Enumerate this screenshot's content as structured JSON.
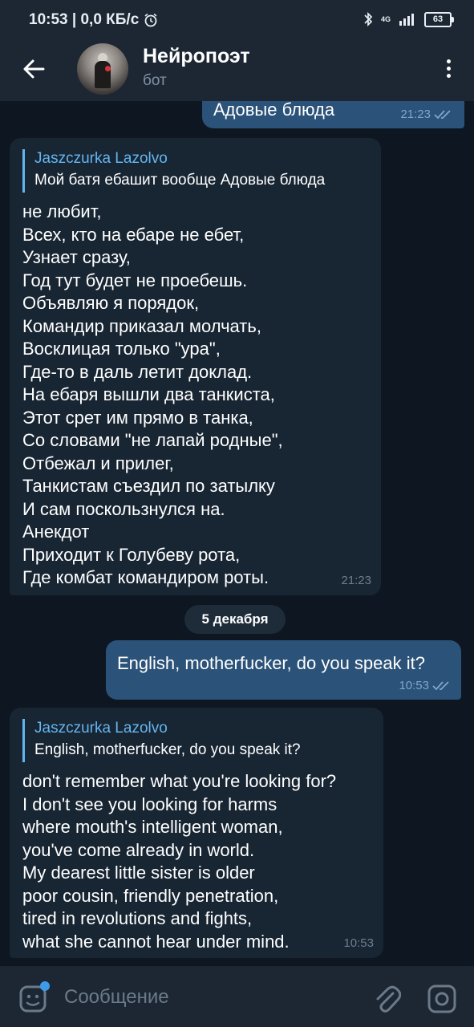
{
  "status_bar": {
    "time_speed": "10:53 | 0,0 КБ/с",
    "network": "4G",
    "battery": "63"
  },
  "header": {
    "title": "Нейропоэт",
    "subtitle": "бот"
  },
  "messages": [
    {
      "type": "outgoing",
      "text": "Адовые блюда",
      "time": "21:23"
    },
    {
      "type": "incoming",
      "reply_name": "Jaszczurka Lazolvo",
      "reply_text": "Мой батя ебашит вообще Адовые блюда",
      "lines": [
        "не любит,",
        "Всех, кто на ебаре не ебет,",
        "Узнает сразу,",
        "Год тут будет не проебешь.",
        "Объявляю я порядок,",
        "Командир приказал молчать,",
        "Восклицая только \"ура\",",
        "Где-то в даль летит доклад.",
        "На ебаря вышли два танкиста,",
        "Этот срет им прямо в танка,",
        "Со словами \"не лапай родные\",",
        "Отбежал и прилег,",
        "Танкистам съездил по затылку",
        "И сам поскользнулся на.",
        "Анекдот",
        "Приходит к Голубеву рота,",
        "Где комбат командиром роты."
      ],
      "time": "21:23"
    },
    {
      "type": "date",
      "text": "5 декабря"
    },
    {
      "type": "outgoing",
      "text": "English, motherfucker, do you speak it?",
      "time": "10:53"
    },
    {
      "type": "incoming",
      "reply_name": "Jaszczurka Lazolvo",
      "reply_text": "English, motherfucker, do you speak it?",
      "lines": [
        "don't remember what you're looking for?",
        "I don't see you looking for harms",
        "where mouth's intelligent woman,",
        "you've come already in world.",
        "My dearest little sister is older",
        "poor cousin, friendly penetration,",
        "tired in revolutions and fights,",
        "what she cannot hear under mind."
      ],
      "time": "10:53"
    }
  ],
  "composer": {
    "placeholder": "Сообщение"
  },
  "colors": {
    "background": "#0e1621",
    "header": "#1d2733",
    "bubble_out": "#2b5278",
    "bubble_in": "#182533",
    "accent": "#64b5ef"
  },
  "icons": [
    "back-arrow-icon",
    "more-vert-icon",
    "emoji-icon",
    "attach-icon",
    "camera-icon",
    "double-check-icon",
    "bluetooth-icon",
    "signal-icon",
    "battery-icon",
    "alarm-icon"
  ]
}
